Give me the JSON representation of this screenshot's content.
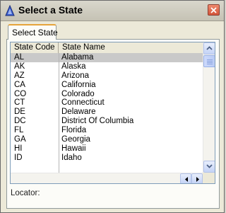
{
  "window": {
    "title": "Select a State",
    "accent_color": "#2f4fb0",
    "close_color": "#d3553a"
  },
  "tabs": [
    {
      "label": "Select State",
      "active": true
    }
  ],
  "grid": {
    "columns": [
      "State Code",
      "State Name"
    ],
    "selected_index": 0,
    "rows": [
      {
        "code": "AL",
        "name": "Alabama"
      },
      {
        "code": "AK",
        "name": "Alaska"
      },
      {
        "code": "AZ",
        "name": "Arizona"
      },
      {
        "code": "CA",
        "name": "California"
      },
      {
        "code": "CO",
        "name": "Colorado"
      },
      {
        "code": "CT",
        "name": "Connecticut"
      },
      {
        "code": "DE",
        "name": "Delaware"
      },
      {
        "code": "DC",
        "name": "District Of Columbia"
      },
      {
        "code": "FL",
        "name": "Florida"
      },
      {
        "code": "GA",
        "name": "Georgia"
      },
      {
        "code": "HI",
        "name": "Hawaii"
      },
      {
        "code": "ID",
        "name": "Idaho"
      }
    ]
  },
  "locator": {
    "label": "Locator:",
    "value": ""
  },
  "icons": {
    "app": "triangle-app-icon",
    "close": "close-x-icon",
    "scroll_up": "arrow-up-icon",
    "scroll_down": "arrow-down-icon",
    "scroll_left": "arrow-left-icon",
    "scroll_right": "arrow-right-icon"
  }
}
